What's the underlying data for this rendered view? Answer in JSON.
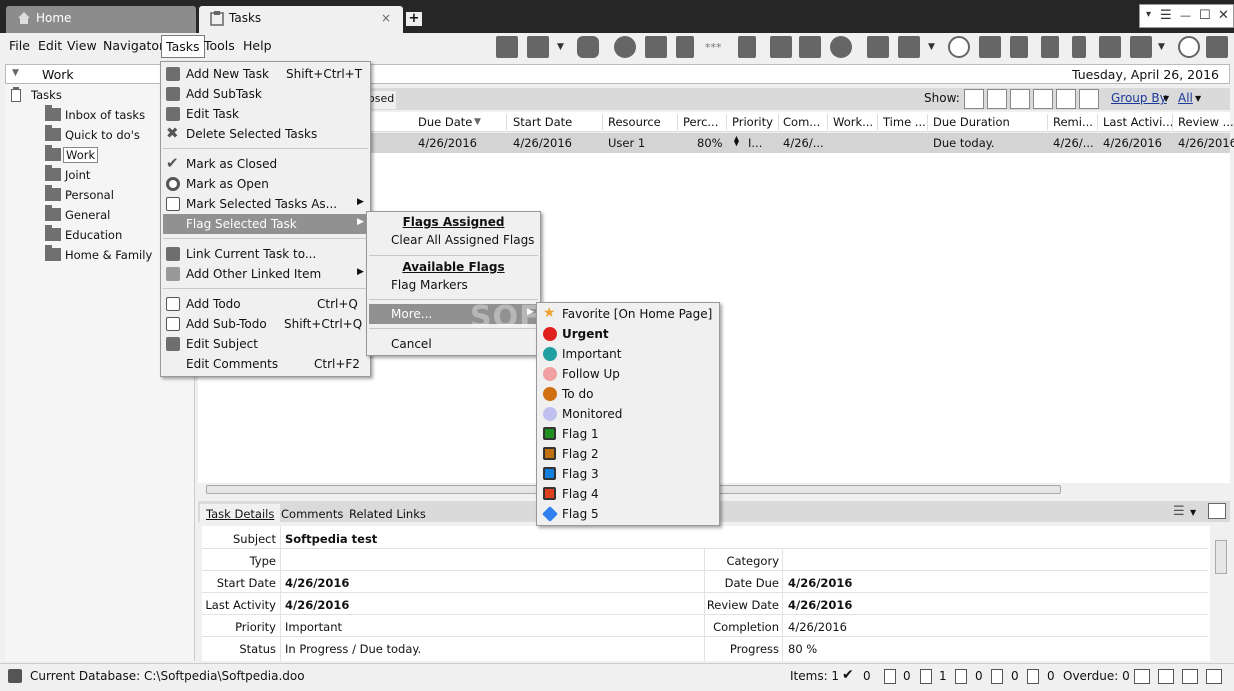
{
  "tabs": [
    {
      "label": "Home"
    },
    {
      "label": "Tasks",
      "close": "×"
    }
  ],
  "newtab_label": "+",
  "window": {
    "min": "—",
    "max": "☐",
    "close": "✕",
    "menu": "☰",
    "down": "▾"
  },
  "menubar": [
    "File",
    "Edit",
    "View",
    "Navigator",
    "Tasks",
    "Tools",
    "Help"
  ],
  "nav": {
    "title": "Work",
    "date": "Tuesday, April 26, 2016"
  },
  "sidebar": {
    "root": "Tasks",
    "items": [
      "Inbox of tasks",
      "Quick to do's",
      "Work",
      "Joint",
      "Personal",
      "General",
      "Education",
      "Home & Family"
    ]
  },
  "showbar": {
    "closed_tab": "osed",
    "show_label": "Show:",
    "group_by": "Group By",
    "all": "All"
  },
  "grid": {
    "headers": [
      "Due Date",
      "Start Date",
      "Resource",
      "Perc...",
      "Priority",
      "Com...",
      "Work...",
      "Time ...",
      "Due Duration",
      "Remi...",
      "Last Activi...",
      "Review ..."
    ],
    "row": [
      "4/26/2016",
      "4/26/2016",
      "User 1",
      "80%",
      "I...",
      "4/26/...",
      "",
      "",
      "Due today.",
      "4/26/...",
      "4/26/2016",
      "4/26/2016"
    ]
  },
  "detail_tabs": [
    "Task Details",
    "Comments",
    "Related Links"
  ],
  "details": {
    "left": [
      {
        "label": "Subject",
        "value": "Softpedia test"
      },
      {
        "label": "Type",
        "value": ""
      },
      {
        "label": "Start Date",
        "value": "4/26/2016"
      },
      {
        "label": "Last Activity",
        "value": "4/26/2016"
      },
      {
        "label": "Priority",
        "value": "Important"
      },
      {
        "label": "Status",
        "value": "In Progress / Due today."
      }
    ],
    "right": [
      {
        "label": "Category",
        "value": ""
      },
      {
        "label": "Date Due",
        "value": "4/26/2016"
      },
      {
        "label": "Review Date",
        "value": "4/26/2016"
      },
      {
        "label": "Completion",
        "value": "4/26/2016"
      },
      {
        "label": "Progress",
        "value": "80 %"
      }
    ]
  },
  "status": {
    "db": "Current Database: C:\\Softpedia\\Softpedia.doo",
    "items": "Items: 1",
    "counts": [
      "0",
      "0",
      "1",
      "0",
      "0",
      "0"
    ],
    "overdue": "Overdue: 0"
  },
  "tasks_menu": [
    {
      "label": "Add New Task",
      "shortcut": "Shift+Ctrl+T"
    },
    {
      "label": "Add SubTask",
      "shortcut": ""
    },
    {
      "label": "Edit Task",
      "shortcut": ""
    },
    {
      "label": "Delete Selected Tasks",
      "shortcut": ""
    },
    {
      "label": "Mark as Closed",
      "shortcut": ""
    },
    {
      "label": "Mark as Open",
      "shortcut": ""
    },
    {
      "label": "Mark Selected Tasks As...",
      "shortcut": ""
    },
    {
      "label": "Flag Selected Task",
      "shortcut": ""
    },
    {
      "label": "Link Current Task to...",
      "shortcut": ""
    },
    {
      "label": "Add Other Linked Item",
      "shortcut": ""
    },
    {
      "label": "Add Todo",
      "shortcut": "Ctrl+Q"
    },
    {
      "label": "Add Sub-Todo",
      "shortcut": "Shift+Ctrl+Q"
    },
    {
      "label": "Edit Subject",
      "shortcut": ""
    },
    {
      "label": "Edit Comments",
      "shortcut": "Ctrl+F2"
    }
  ],
  "flag_menu": {
    "assigned_header": "Flags Assigned",
    "clear": "Clear All Assigned Flags",
    "available_header": "Available Flags",
    "markers": "Flag Markers",
    "more": "More...",
    "cancel": "Cancel"
  },
  "flags": [
    {
      "label": "Favorite [On Home Page]",
      "color": "#f0a030"
    },
    {
      "label": "Urgent",
      "color": "#e02020"
    },
    {
      "label": "Important",
      "color": "#20a0a0"
    },
    {
      "label": "Follow Up",
      "color": "#f0a0a0"
    },
    {
      "label": "To do",
      "color": "#d07010"
    },
    {
      "label": "Monitored",
      "color": "#c0c0f0"
    },
    {
      "label": "Flag 1",
      "color": "#209020"
    },
    {
      "label": "Flag 2",
      "color": "#c07010"
    },
    {
      "label": "Flag 3",
      "color": "#1080e0"
    },
    {
      "label": "Flag 4",
      "color": "#e04020"
    },
    {
      "label": "Flag 5",
      "color": "#3080f0"
    }
  ],
  "watermark": "SOFTPEDIA"
}
